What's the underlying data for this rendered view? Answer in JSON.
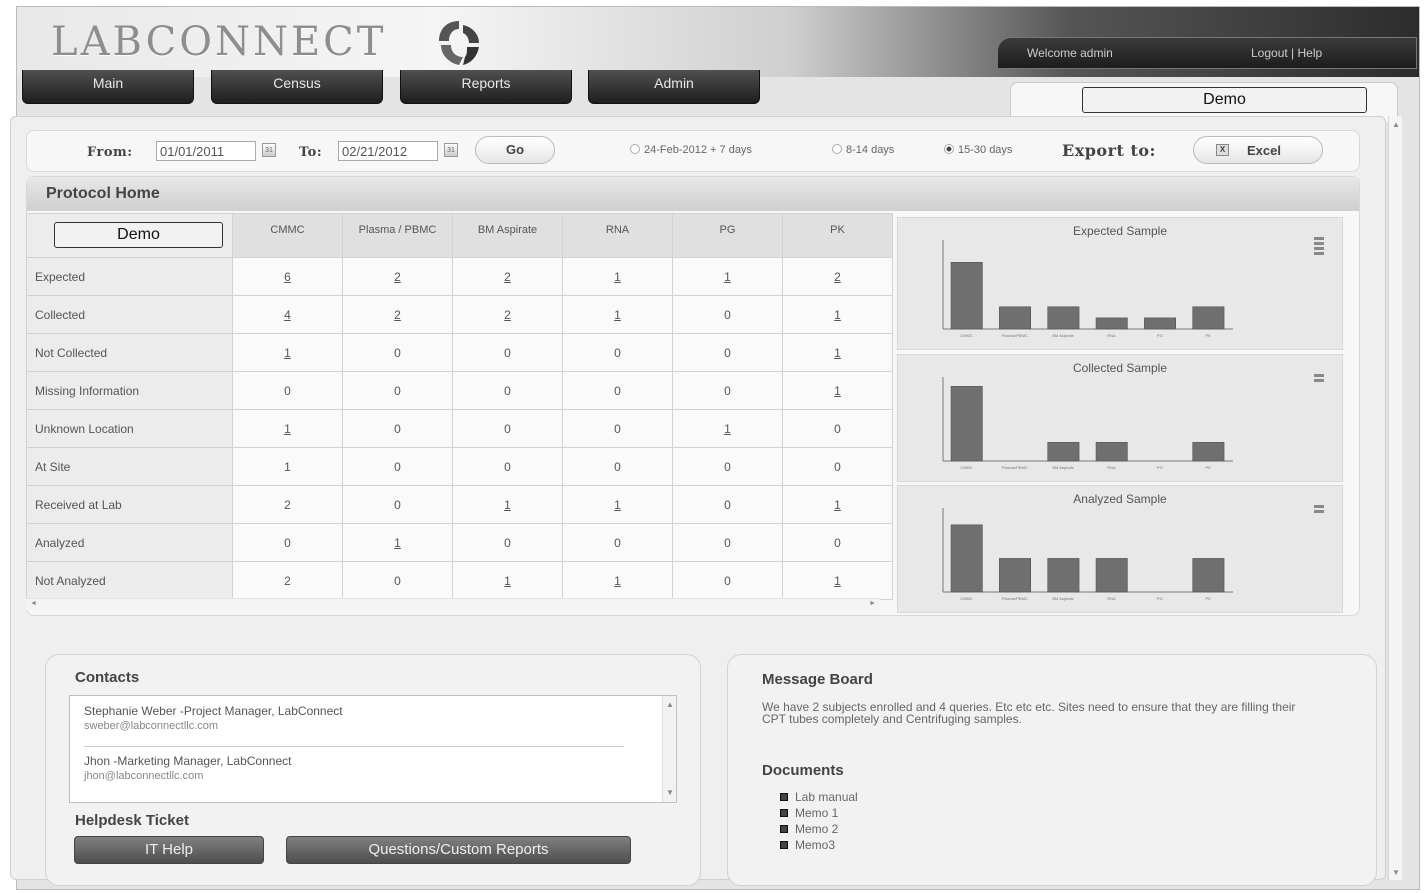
{
  "app": {
    "logo_text": "LABCONNECT",
    "welcome": "Welcome admin",
    "logout": "Logout | Help"
  },
  "nav": [
    "Main",
    "Census",
    "Reports",
    "Admin"
  ],
  "demo_tab_label": "Demo",
  "filter": {
    "from_label": "From:",
    "from_value": "01/01/2011",
    "to_label": "To:",
    "to_value": "02/21/2012",
    "go_label": "Go",
    "radios": [
      {
        "label": "24-Feb-2012 + 7 days",
        "selected": false
      },
      {
        "label": "8-14 days",
        "selected": false
      },
      {
        "label": "15-30 days",
        "selected": true
      }
    ],
    "export_label": "Export to:",
    "excel_label": "Excel"
  },
  "protocol": {
    "title": "Protocol Home",
    "corner_label": "Demo",
    "columns": [
      "CMMC",
      "Plasma / PBMC",
      "BM Aspirate",
      "RNA",
      "PG",
      "PK"
    ],
    "rows": [
      {
        "label": "Expected",
        "values": [
          "6",
          "2",
          "2",
          "1",
          "1",
          "2"
        ]
      },
      {
        "label": "Collected",
        "values": [
          "4",
          "2",
          "2",
          "1",
          "0",
          "1"
        ]
      },
      {
        "label": "Not Collected",
        "values": [
          "1",
          "0",
          "0",
          "0",
          "0",
          "1"
        ]
      },
      {
        "label": "Missing Information",
        "values": [
          "0",
          "0",
          "0",
          "0",
          "0",
          "1"
        ]
      },
      {
        "label": "Unknown Location",
        "values": [
          "1",
          "0",
          "0",
          "0",
          "1",
          "0"
        ]
      },
      {
        "label": "At Site",
        "values": [
          "1",
          "0",
          "0",
          "0",
          "0",
          "0"
        ]
      },
      {
        "label": "Received at Lab",
        "values": [
          "2",
          "0",
          "1",
          "1",
          "0",
          "1"
        ]
      },
      {
        "label": "Analyzed",
        "values": [
          "0",
          "1",
          "0",
          "0",
          "0",
          "0"
        ]
      },
      {
        "label": "Not Analyzed",
        "values": [
          "2",
          "0",
          "1",
          "1",
          "0",
          "1"
        ]
      }
    ]
  },
  "chart_data": [
    {
      "type": "bar",
      "title": "Expected Sample",
      "categories": [
        "CMMC",
        "Plasma/PBMC",
        "BM Aspirate",
        "RNA",
        "PG",
        "PK"
      ],
      "values": [
        6,
        2,
        2,
        1,
        1,
        2
      ],
      "ylim": [
        0,
        8
      ]
    },
    {
      "type": "bar",
      "title": "Collected Sample",
      "categories": [
        "CMMC",
        "Plasma/PBMC",
        "BM Aspirate",
        "RNA",
        "PG",
        "PK"
      ],
      "values": [
        4,
        0,
        1,
        1,
        0,
        1
      ],
      "ylim": [
        0,
        4.5
      ]
    },
    {
      "type": "bar",
      "title": "Analyzed Sample",
      "categories": [
        "CMMC",
        "Plasma/PBMC",
        "BM Aspirate",
        "RNA",
        "PG",
        "PK"
      ],
      "values": [
        2,
        1,
        1,
        1,
        0,
        1
      ],
      "ylim": [
        0,
        2.5
      ]
    }
  ],
  "contacts": {
    "title": "Contacts",
    "items": [
      {
        "name": "Stephanie Weber -Project Manager, LabConnect",
        "email": "sweber@labconnectllc.com"
      },
      {
        "name": "Jhon -Marketing Manager, LabConnect",
        "email": "jhon@labconnectllc.com"
      }
    ]
  },
  "helpdesk": {
    "title": "Helpdesk Ticket",
    "it_help": "IT Help",
    "questions": "Questions/Custom Reports"
  },
  "message_board": {
    "title": "Message Board",
    "text": "We have 2 subjects enrolled and 4 queries. Etc etc etc. Sites need to ensure that they are filling their CPT tubes completely and Centrifuging samples."
  },
  "documents": {
    "title": "Documents",
    "items": [
      "Lab manual",
      "Memo 1",
      "Memo 2",
      "Memo3"
    ]
  }
}
